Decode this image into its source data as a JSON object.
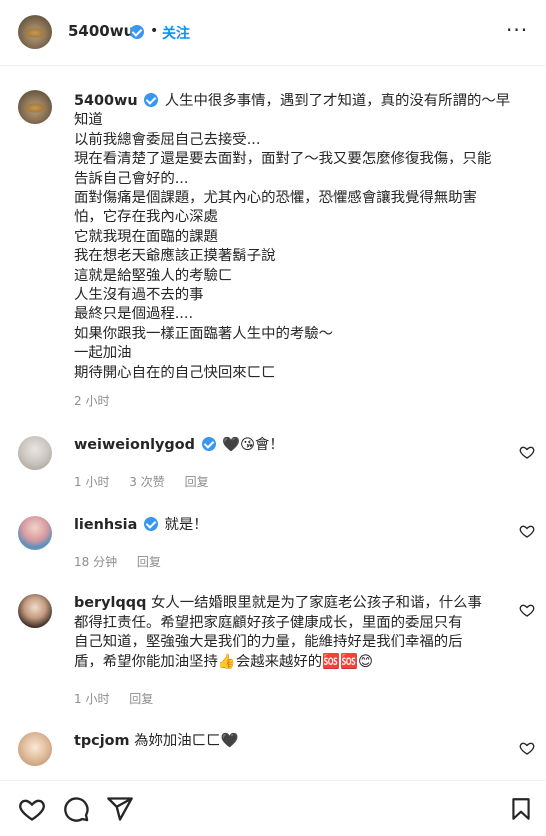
{
  "header": {
    "username": "5400wu",
    "separator": "•",
    "follow_label": "关注",
    "more_label": "···"
  },
  "caption": {
    "username": "5400wu",
    "lines": [
      "人生中很多事情，遇到了才知道，真的没有所謂的～早",
      "知道",
      "以前我總會委屈自己去接受...",
      "現在看清楚了還是要去面對，面對了～我又要怎麼修復我傷，只能",
      "告訴自己會好的...",
      "面對傷痛是個課題，尤其內心的恐懼，恐懼感會讓我覺得無助害",
      "怕，它存在我內心深處",
      "它就我現在面臨的課題",
      "我在想老天爺應該正摸著鬍子說",
      "這就是給堅強人的考驗ㄈ",
      "人生沒有過不去的事",
      "最終只是個過程....",
      "如果你跟我一樣正面臨著人生中的考驗～",
      "一起加油",
      "期待開心自在的自己快回來ㄈㄈ"
    ],
    "time": "2 小时"
  },
  "comments": [
    {
      "username": "weiweionlygod",
      "text": "🖤😘會！",
      "time": "1 小时",
      "likes": "3 次赞",
      "reply": "回复"
    },
    {
      "username": "lienhsia",
      "text": "就是！",
      "time": "18 分钟",
      "reply": "回复"
    },
    {
      "username": "berylqqq",
      "lines": [
        "女人一结婚眼里就是为了家庭老公孩子和谐，什么事",
        "都得扛责任。希望把家庭顧好孩子健康成长，里面的委屈只有",
        "自己知道，堅強強大是我们的力量，能維持好是我们幸福的后",
        "盾，希望你能加油坚持👍会越来越好的🆘🆘😊"
      ],
      "time": "1 小时",
      "reply": "回复"
    },
    {
      "username": "tpcjom",
      "text": "為妳加油ㄈㄈ🖤"
    }
  ],
  "icons": {
    "verified": "verified-badge-icon",
    "more": "more-options-icon",
    "heart": "heart-icon",
    "comment": "comment-icon",
    "share": "share-icon",
    "save": "bookmark-icon"
  },
  "colors": {
    "accent": "#0095f6",
    "verified": "#3897f0",
    "muted": "#8e8e8e"
  }
}
